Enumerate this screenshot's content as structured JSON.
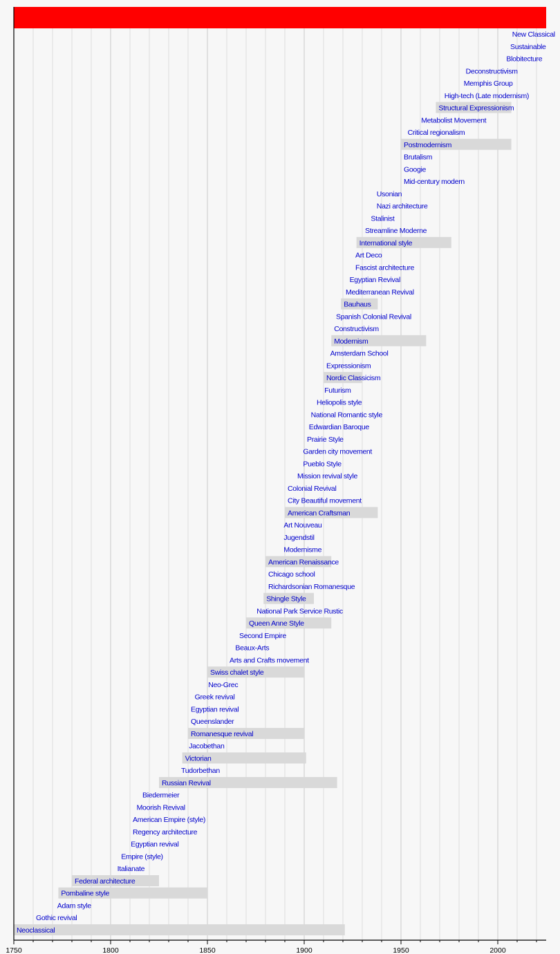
{
  "chart_data": {
    "type": "timeline",
    "title": "",
    "xlabel": "",
    "ylabel": "",
    "xlim": [
      1750,
      2025
    ],
    "x_ticks": [
      1750,
      1800,
      1850,
      1900,
      1950,
      2000
    ],
    "minor_tick_step": 10,
    "grid": true,
    "header_bar_color": "#ff0000",
    "bar_color": "#d9d9d9",
    "label_color": "#0000cc",
    "items": [
      {
        "label": "New Classical",
        "start": 2006
      },
      {
        "label": "Sustainable",
        "start": 2005
      },
      {
        "label": "Blobitecture",
        "start": 2003
      },
      {
        "label": "Deconstructivism",
        "start": 1982
      },
      {
        "label": "Memphis Group",
        "start": 1981
      },
      {
        "label": "High-tech (Late modernism)",
        "start": 1971
      },
      {
        "label": "Structural Expressionism",
        "start": 1968,
        "end": 2007
      },
      {
        "label": "Metabolist Movement",
        "start": 1959
      },
      {
        "label": "Critical regionalism",
        "start": 1952
      },
      {
        "label": "Postmodernism",
        "start": 1950,
        "end": 2007
      },
      {
        "label": "Brutalism",
        "start": 1950
      },
      {
        "label": "Googie",
        "start": 1950
      },
      {
        "label": "Mid-century modern",
        "start": 1950
      },
      {
        "label": "Usonian",
        "start": 1936
      },
      {
        "label": "Nazi architecture",
        "start": 1936
      },
      {
        "label": "Stalinist",
        "start": 1933
      },
      {
        "label": "Streamline Moderne",
        "start": 1930
      },
      {
        "label": "International style",
        "start": 1927,
        "end": 1976
      },
      {
        "label": "Art Deco",
        "start": 1925
      },
      {
        "label": "Fascist architecture",
        "start": 1925
      },
      {
        "label": "Egyptian Revival",
        "start": 1922
      },
      {
        "label": "Mediterranean Revival",
        "start": 1920
      },
      {
        "label": "Bauhaus",
        "start": 1919,
        "end": 1938
      },
      {
        "label": "Spanish Colonial Revival",
        "start": 1915
      },
      {
        "label": "Constructivism",
        "start": 1914
      },
      {
        "label": "Modernism",
        "start": 1914,
        "end": 1963
      },
      {
        "label": "Amsterdam School",
        "start": 1912
      },
      {
        "label": "Expressionism",
        "start": 1910
      },
      {
        "label": "Nordic Classicism",
        "start": 1910,
        "end": 1930
      },
      {
        "label": "Futurism",
        "start": 1909
      },
      {
        "label": "Heliopolis style",
        "start": 1905
      },
      {
        "label": "National Romantic style",
        "start": 1902
      },
      {
        "label": "Edwardian Baroque",
        "start": 1901
      },
      {
        "label": "Prairie Style",
        "start": 1900
      },
      {
        "label": "Garden city movement",
        "start": 1898
      },
      {
        "label": "Pueblo Style",
        "start": 1898
      },
      {
        "label": "Mission revival style",
        "start": 1895
      },
      {
        "label": "Colonial Revival",
        "start": 1890
      },
      {
        "label": "City Beautiful movement",
        "start": 1890
      },
      {
        "label": "American Craftsman",
        "start": 1890,
        "end": 1938
      },
      {
        "label": "Art Nouveau",
        "start": 1888
      },
      {
        "label": "Jugendstil",
        "start": 1888
      },
      {
        "label": "Modernisme",
        "start": 1888
      },
      {
        "label": "American Renaissance",
        "start": 1880,
        "end": 1914
      },
      {
        "label": "Chicago school",
        "start": 1880
      },
      {
        "label": "Richardsonian Romanesque",
        "start": 1880
      },
      {
        "label": "Shingle Style",
        "start": 1879,
        "end": 1905
      },
      {
        "label": "National Park Service Rustic",
        "start": 1874
      },
      {
        "label": "Queen Anne Style",
        "start": 1870,
        "end": 1914
      },
      {
        "label": "Second Empire",
        "start": 1865
      },
      {
        "label": "Beaux-Arts",
        "start": 1863
      },
      {
        "label": "Arts and Crafts movement",
        "start": 1860
      },
      {
        "label": "Swiss chalet style",
        "start": 1850,
        "end": 1900
      },
      {
        "label": "Neo-Grec",
        "start": 1849
      },
      {
        "label": "Greek revival",
        "start": 1842
      },
      {
        "label": "Egyptian revival",
        "start": 1840
      },
      {
        "label": "Queenslander",
        "start": 1840
      },
      {
        "label": "Romanesque revival",
        "start": 1840,
        "end": 1900
      },
      {
        "label": "Jacobethan",
        "start": 1839
      },
      {
        "label": "Victorian",
        "start": 1837,
        "end": 1901
      },
      {
        "label": "Tudorbethan",
        "start": 1835
      },
      {
        "label": "Russian Revival",
        "start": 1825,
        "end": 1917
      },
      {
        "label": "Biedermeier",
        "start": 1815
      },
      {
        "label": "Moorish Revival",
        "start": 1812
      },
      {
        "label": "American Empire (style)",
        "start": 1810
      },
      {
        "label": "Regency architecture",
        "start": 1810
      },
      {
        "label": "Egyptian revival",
        "start": 1809
      },
      {
        "label": "Empire (style)",
        "start": 1804
      },
      {
        "label": "Italianate",
        "start": 1802
      },
      {
        "label": "Federal architecture",
        "start": 1780,
        "end": 1825
      },
      {
        "label": "Pombaline style",
        "start": 1773,
        "end": 1850
      },
      {
        "label": "Adam style",
        "start": 1771
      },
      {
        "label": "Gothic revival",
        "start": 1760
      },
      {
        "label": "Neoclassical",
        "start": 1750,
        "end": 1921
      }
    ]
  }
}
